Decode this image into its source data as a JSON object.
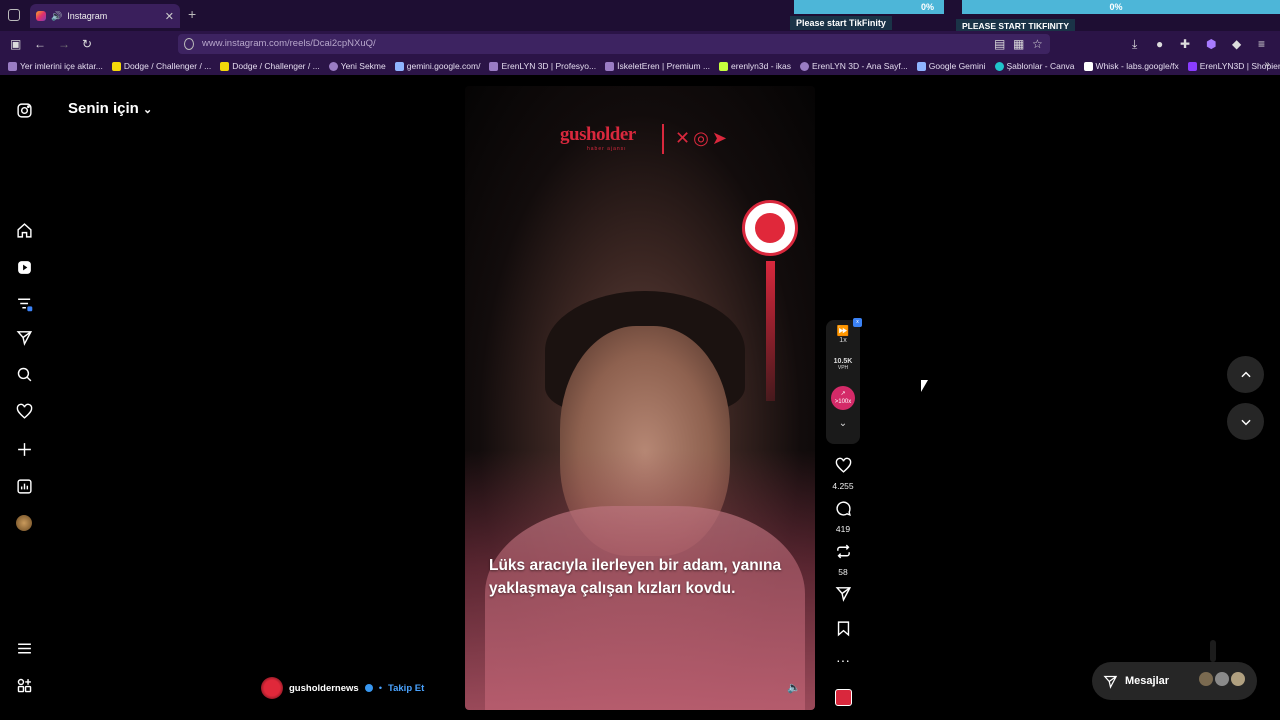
{
  "browser": {
    "tab_title": "Instagram",
    "url": "www.instagram.com/reels/Dcai2cpNXuQ/",
    "overlay1_percent": "0%",
    "overlay1_label": "Please start TikFinity",
    "overlay2_percent": "0%",
    "overlay2_label": "PLEASE START TIKFINITY",
    "bookmarks": [
      "Yer imlerini içe aktar...",
      "Dodge / Challenger / ...",
      "Dodge / Challenger / ...",
      "Yeni Sekme",
      "gemini.google.com/",
      "ErenLYN 3D | Profesyo...",
      "İskeletEren | Premium ...",
      "erenlyn3d - ikas",
      "ErenLYN 3D - Ana Sayf...",
      "Google Gemini",
      "Şablonlar - Canva",
      "Whisk - labs.google/fx",
      "ErenLYN3D | Shopier"
    ]
  },
  "feed": {
    "title": "Senin için"
  },
  "reel": {
    "brand": "gusholder",
    "brand_sub": "haber ajansı",
    "caption": "Lüks aracıyla ilerleyen bir adam, yanına yaklaşmaya çalışan kızları kovdu.",
    "author": "gusholdernews",
    "follow": "Takip Et",
    "speed": "1x",
    "vph": "10.5K",
    "vph_label": "VPH",
    "boost": ">100x",
    "likes": "4.255",
    "comments": "419",
    "reposts": "58"
  },
  "messages": {
    "label": "Mesajlar"
  },
  "colors": {
    "chrome_bg": "#2b1447",
    "brand_red": "#d9283d",
    "link_blue": "#4aa3ff"
  }
}
